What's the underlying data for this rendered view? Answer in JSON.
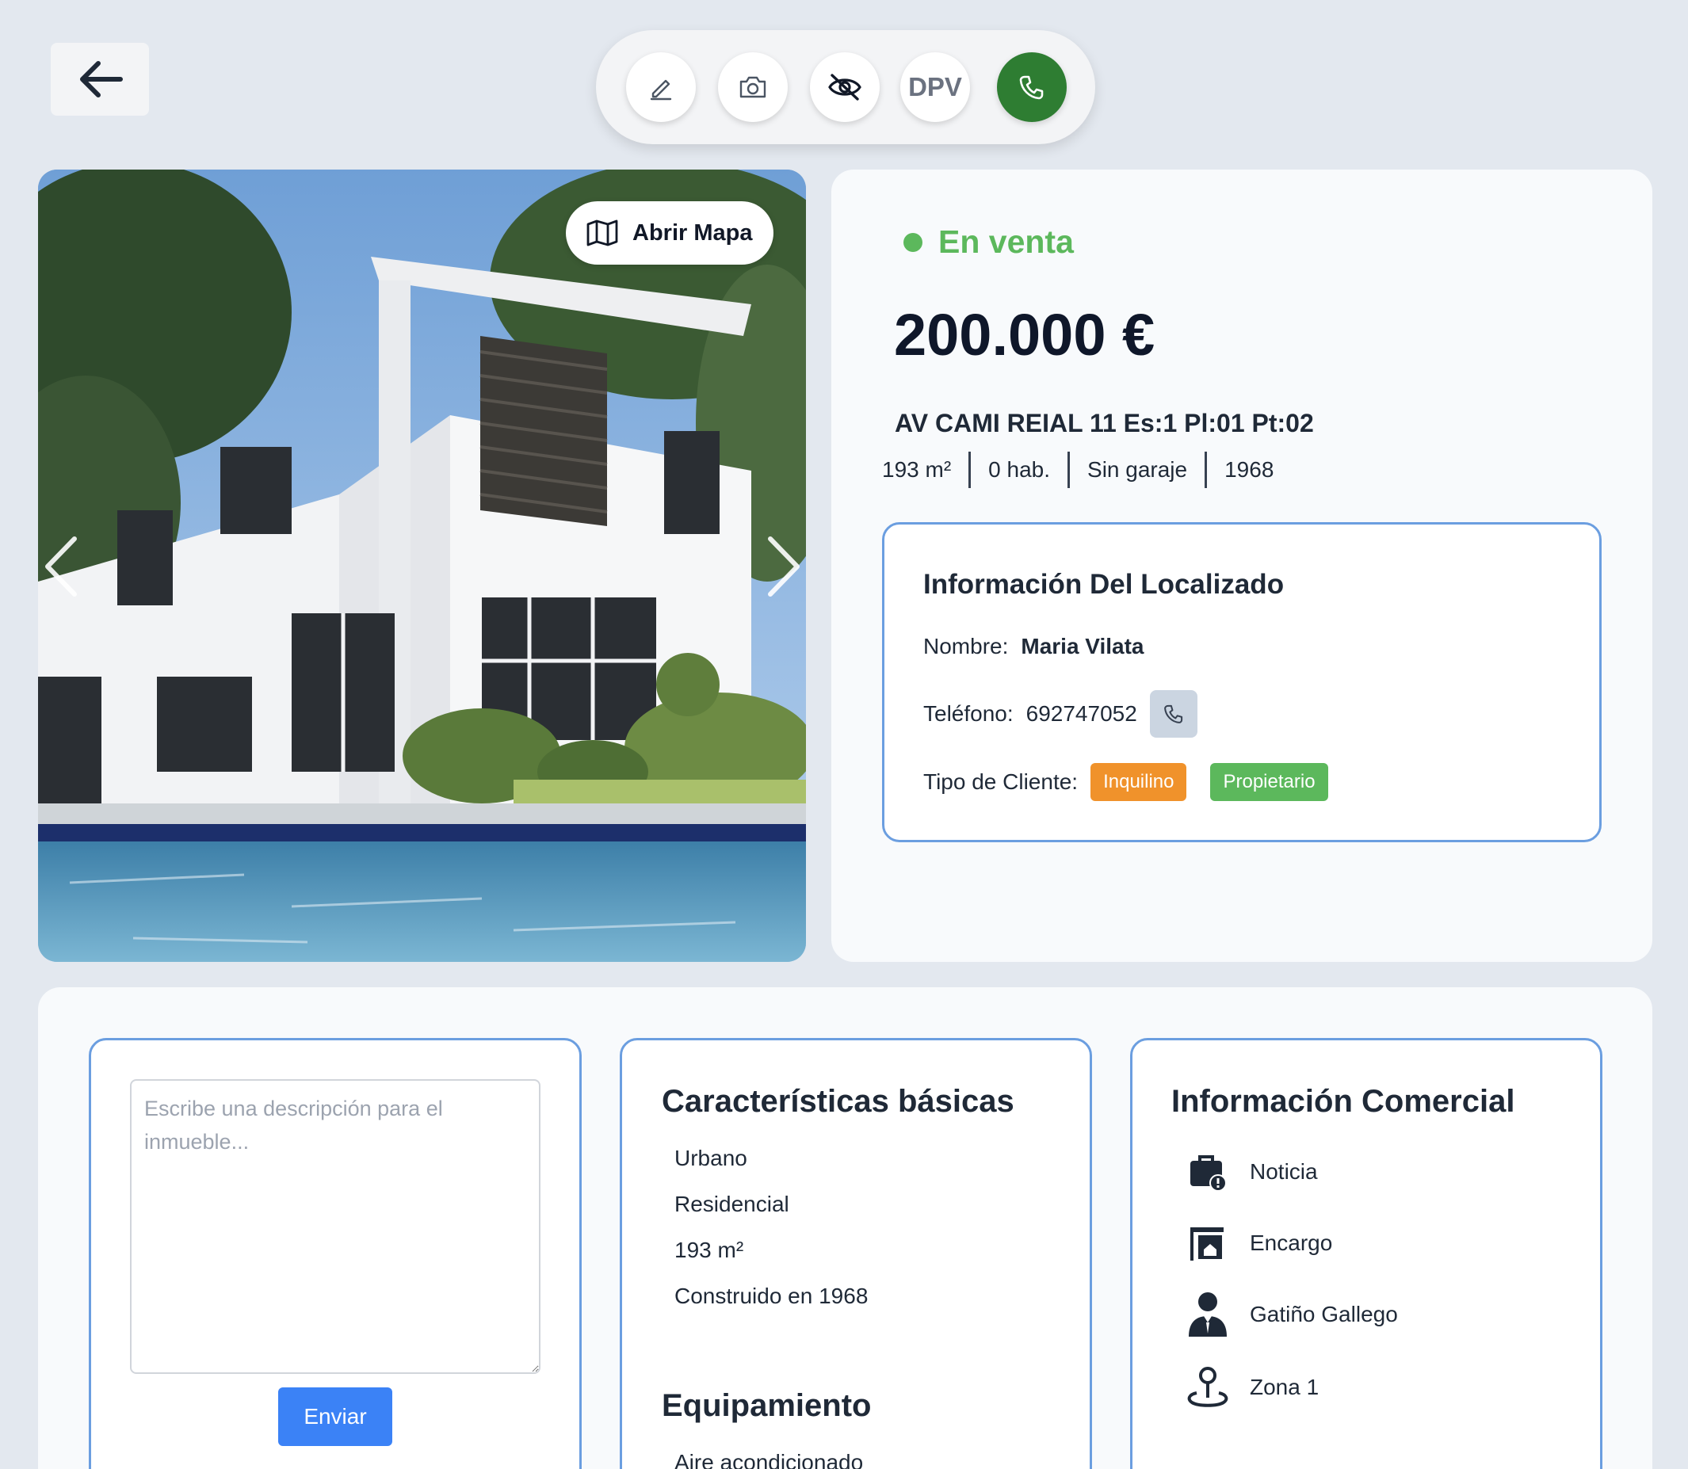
{
  "toolbar": {
    "dpv_label": "DPV"
  },
  "photo": {
    "open_map_label": "Abrir Mapa"
  },
  "listing": {
    "status": "En venta",
    "price": "200.000 €",
    "address": "AV CAMI REIAL 11 Es:1 Pl:01 Pt:02",
    "specs": [
      "193 m²",
      "0 hab.",
      "Sin garaje",
      "1968"
    ]
  },
  "locator": {
    "title": "Información Del Localizado",
    "name_label": "Nombre:",
    "name_value": "Maria Vilata",
    "phone_label": "Teléfono:",
    "phone_value": "692747052",
    "client_type_label": "Tipo de Cliente:",
    "client_types": [
      "Inquilino",
      "Propietario"
    ]
  },
  "description": {
    "placeholder": "Escribe una descripción para el inmueble...",
    "send_label": "Enviar"
  },
  "features": {
    "title": "Características básicas",
    "items": [
      "Urbano",
      "Residencial",
      "193 m²",
      "Construido en 1968"
    ],
    "equipment_title": "Equipamiento",
    "equipment_items": [
      "Aire acondicionado"
    ]
  },
  "commercial": {
    "title": "Información Comercial",
    "items": [
      {
        "icon": "briefcase-alert-icon",
        "label": "Noticia"
      },
      {
        "icon": "store-assignment-icon",
        "label": "Encargo"
      },
      {
        "icon": "agent-person-icon",
        "label": "Gatiño Gallego"
      },
      {
        "icon": "map-pin-zone-icon",
        "label": "Zona 1"
      }
    ]
  },
  "colors": {
    "status_green": "#5cb85c",
    "call_green": "#2e7d32",
    "accent_blue": "#3b82f6",
    "panel_border": "#6b9ee0",
    "chip_orange": "#f0922b"
  }
}
